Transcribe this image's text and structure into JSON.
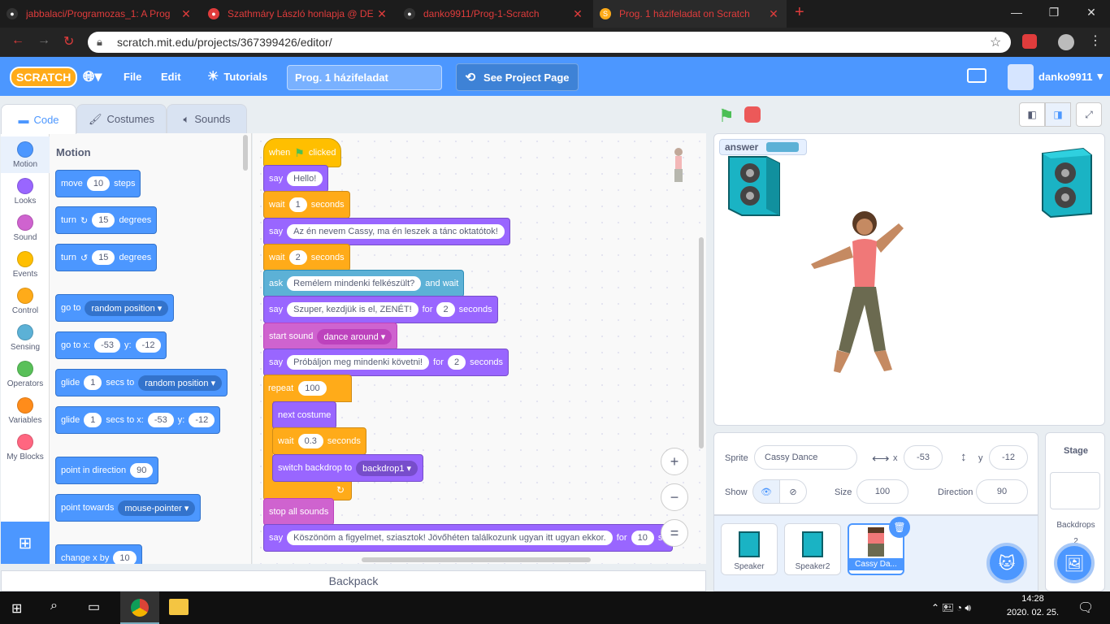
{
  "browser": {
    "tabs": [
      {
        "title": "jabbalaci/Programozas_1: A Prog"
      },
      {
        "title": "Szathmáry László honlapja @ DE"
      },
      {
        "title": "danko9911/Prog-1-Scratch"
      },
      {
        "title": "Prog. 1 házifeladat on Scratch"
      }
    ],
    "url": "scratch.mit.edu/projects/367399426/editor/"
  },
  "menubar": {
    "logo": "SCRATCH",
    "file": "File",
    "edit": "Edit",
    "tutorials": "Tutorials",
    "project_title": "Prog. 1 házifeladat",
    "see_project": "See Project Page",
    "username": "danko9911"
  },
  "editor_tabs": {
    "code": "Code",
    "costumes": "Costumes",
    "sounds": "Sounds"
  },
  "categories": [
    {
      "label": "Motion",
      "color": "#4c97ff"
    },
    {
      "label": "Looks",
      "color": "#9966ff"
    },
    {
      "label": "Sound",
      "color": "#cf63cf"
    },
    {
      "label": "Events",
      "color": "#ffbf00"
    },
    {
      "label": "Control",
      "color": "#ffab19"
    },
    {
      "label": "Sensing",
      "color": "#5cb1d6"
    },
    {
      "label": "Operators",
      "color": "#59c059"
    },
    {
      "label": "Variables",
      "color": "#ff8c1a"
    },
    {
      "label": "My Blocks",
      "color": "#ff6680"
    }
  ],
  "palette": {
    "heading": "Motion",
    "move": {
      "a": "move",
      "v": "10",
      "b": "steps"
    },
    "turn_right": {
      "a": "turn",
      "v": "15",
      "b": "degrees"
    },
    "turn_left": {
      "a": "turn",
      "v": "15",
      "b": "degrees"
    },
    "goto": {
      "a": "go to",
      "dd": "random position"
    },
    "gotoxy": {
      "a": "go to x:",
      "x": "-53",
      "yl": "y:",
      "y": "-12"
    },
    "glide1": {
      "a": "glide",
      "v": "1",
      "b": "secs to",
      "dd": "random position"
    },
    "glide2": {
      "a": "glide",
      "v": "1",
      "b": "secs to x:",
      "x": "-53",
      "yl": "y:",
      "y": "-12"
    },
    "point_dir": {
      "a": "point in direction",
      "v": "90"
    },
    "point_towards": {
      "a": "point towards",
      "dd": "mouse-pointer"
    },
    "change_x": {
      "a": "change x by",
      "v": "10"
    }
  },
  "script": {
    "hat": {
      "a": "when",
      "b": "clicked"
    },
    "say1": {
      "a": "say",
      "v": "Hello!"
    },
    "wait1": {
      "a": "wait",
      "v": "1",
      "b": "seconds"
    },
    "say2": {
      "a": "say",
      "v": "Az én nevem Cassy, ma én leszek a tánc oktatótok!"
    },
    "wait2": {
      "a": "wait",
      "v": "2",
      "b": "seconds"
    },
    "ask": {
      "a": "ask",
      "v": "Remélem mindenki felkészült?",
      "b": "and wait"
    },
    "say3": {
      "a": "say",
      "v": "Szuper, kezdjük is el, ZENÉT!",
      "b": "for",
      "n": "2",
      "c": "seconds"
    },
    "start_sound": {
      "a": "start sound",
      "dd": "dance around"
    },
    "say4": {
      "a": "say",
      "v": "Próbáljon meg mindenki követni!",
      "b": "for",
      "n": "2",
      "c": "seconds"
    },
    "repeat": {
      "a": "repeat",
      "v": "100"
    },
    "next_costume": {
      "a": "next costume"
    },
    "wait3": {
      "a": "wait",
      "v": "0.3",
      "b": "seconds"
    },
    "switch_backdrop": {
      "a": "switch backdrop to",
      "dd": "backdrop1"
    },
    "stop_sounds": {
      "a": "stop all sounds"
    },
    "say5": {
      "a": "say",
      "v": "Köszönöm a figyelmet, sziasztok! Jövőhéten találkozunk ugyan itt ugyan ekkor.",
      "b": "for",
      "n": "10",
      "c": "se"
    }
  },
  "zoom": {
    "in": "+",
    "out": "−",
    "reset": "="
  },
  "stage": {
    "monitor_label": "answer"
  },
  "sprite_info": {
    "sprite_label": "Sprite",
    "sprite_name": "Cassy Dance",
    "x_label": "x",
    "x": "-53",
    "y_label": "y",
    "y": "-12",
    "show_label": "Show",
    "size_label": "Size",
    "size": "100",
    "direction_label": "Direction",
    "direction": "90"
  },
  "sprites": [
    {
      "name": "Speaker"
    },
    {
      "name": "Speaker2"
    },
    {
      "name": "Cassy Da..."
    }
  ],
  "stage_panel": {
    "title": "Stage",
    "backdrops_label": "Backdrops",
    "backdrops_count": "2"
  },
  "backpack": "Backpack",
  "taskbar": {
    "time": "14:28",
    "date": "2020. 02. 25."
  }
}
